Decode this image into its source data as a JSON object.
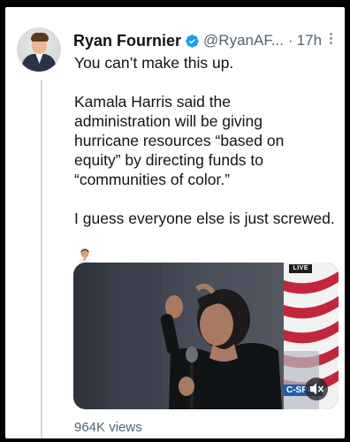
{
  "tweet": {
    "author_name": "Ryan Fournier",
    "handle": "@RyanAF...",
    "separator": "·",
    "time": "17h",
    "text_lines_1": [
      "You can’t make this up."
    ],
    "text_lines_2": [
      "Kamala Harris said the",
      "administration will be giving",
      "hurricane resources “based on",
      "equity” by directing funds to",
      "“communities of color.”"
    ],
    "text_lines_3": [
      "I guess everyone else is just screwed."
    ],
    "emoji": "person-facepalming-icon",
    "views": "964K views"
  },
  "media": {
    "live_label": "LIVE",
    "network_logo": "C-SPAN"
  },
  "colors": {
    "background": "#000000",
    "card": "#ffffff",
    "text": "#0f1419",
    "secondary": "#536471",
    "verified": "#1d9bf0"
  }
}
